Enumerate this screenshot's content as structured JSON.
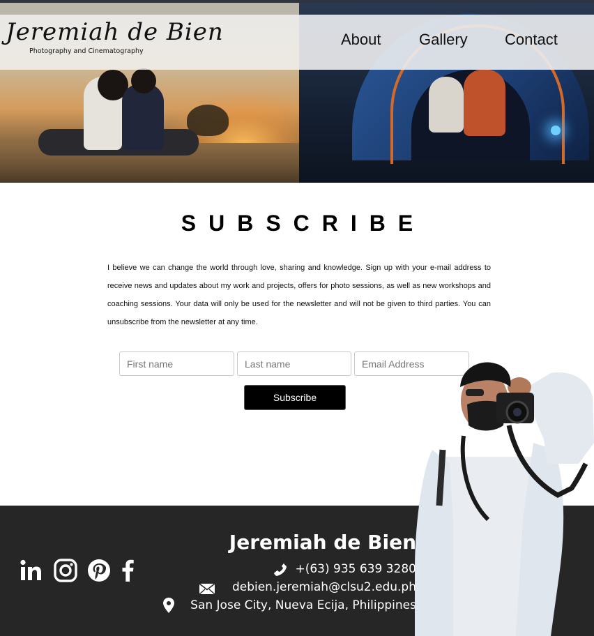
{
  "brand": {
    "name_script": "Jeremiah de Bien",
    "tagline": "Photography and Cinematography"
  },
  "nav": {
    "about": "About",
    "gallery": "Gallery",
    "contact": "Contact"
  },
  "subscribe": {
    "title": "SUBSCRIBE",
    "body": "I believe we can change the world through love, sharing and knowledge. Sign up with your e-mail address to receive news and updates about my work and projects, offers for photo sessions, as well as new workshops and coaching sessions. Your data will only be used for the newsletter and will not be given to third parties. You can unsubscribe from the newsletter at any time.",
    "first_name_placeholder": "First name",
    "last_name_placeholder": "Last name",
    "email_placeholder": "Email Address",
    "button_label": "Subscribe"
  },
  "footer": {
    "name": "Jeremiah de Bien",
    "phone": "+(63) 935 639 3280",
    "email": "debien.jeremiah@clsu2.edu.ph",
    "address": "San Jose City, Nueva Ecija, Philippines",
    "social_icons": [
      "linkedin-icon",
      "instagram-icon",
      "pinterest-icon",
      "facebook-icon"
    ]
  },
  "colors": {
    "footer_bg": "#262626",
    "button_bg": "#000000",
    "text_dark": "#111111",
    "text_light": "#ffffff"
  }
}
